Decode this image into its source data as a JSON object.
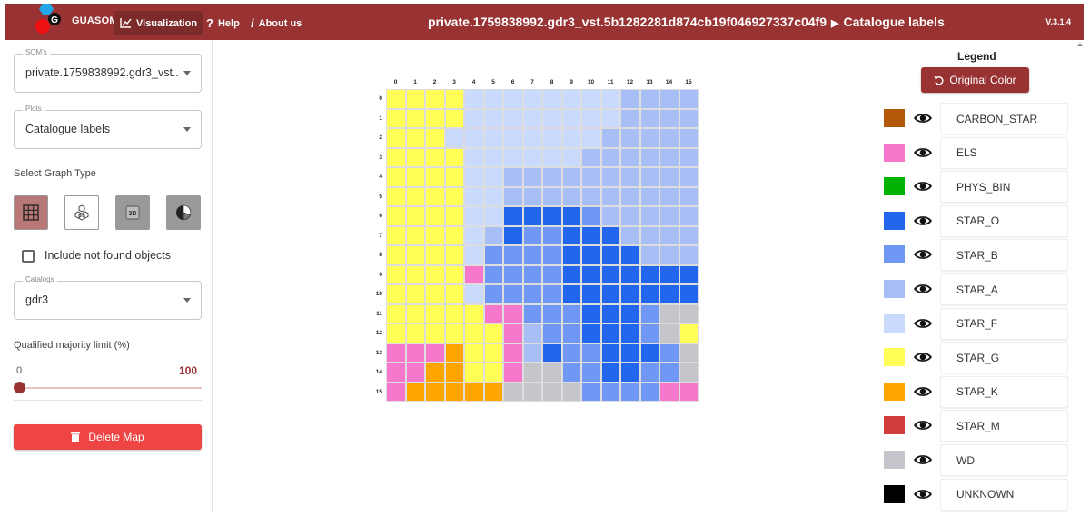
{
  "app": {
    "brand": "GUASOM",
    "nav": [
      {
        "label": "Visualization",
        "icon": "chart-icon"
      },
      {
        "label": "Help",
        "icon": "help-icon"
      },
      {
        "label": "About us",
        "icon": "info-icon"
      }
    ],
    "title_map": "private.1759838992.gdr3_vst.5b1282281d874cb19f046927337c04f9",
    "title_plot": "Catalogue labels",
    "version": "V.3.1.4",
    "colors": {
      "brand": "#993333",
      "brand_dark": "#7d2a2a",
      "danger": "#ee4444"
    }
  },
  "left": {
    "soms_label": "SOM's",
    "soms_value": "private.1759838992.gdr3_vst...",
    "plots_label": "Plots",
    "plots_value": "Catalogue labels",
    "graph_type_label": "Select Graph Type",
    "graph_types": [
      {
        "name": "square-grid",
        "selected": true
      },
      {
        "name": "hexagon-grid",
        "selected": false
      },
      {
        "name": "3d-view",
        "selected": false
      },
      {
        "name": "pie-chart",
        "selected": false
      }
    ],
    "include_label": "Include not found objects",
    "include_checked": false,
    "catalogs_label": "Catalogs",
    "catalogs_value": "gdr3",
    "majority_label": "Qualified majority limit (%)",
    "slider_min": "0",
    "slider_max": "100",
    "slider_value": 0,
    "delete_label": "Delete Map"
  },
  "grid": {
    "col_labels": [
      "0",
      "1",
      "2",
      "3",
      "4",
      "5",
      "6",
      "7",
      "8",
      "9",
      "10",
      "11",
      "12",
      "13",
      "14",
      "15"
    ],
    "row_labels": [
      "0",
      "1",
      "2",
      "3",
      "4",
      "5",
      "6",
      "7",
      "8",
      "9",
      "10",
      "11",
      "12",
      "13",
      "14",
      "15"
    ],
    "cells": [
      [
        "G",
        "G",
        "G",
        "G",
        "F",
        "F",
        "F",
        "F",
        "F",
        "F",
        "F",
        "F",
        "A",
        "A",
        "A",
        "A"
      ],
      [
        "G",
        "G",
        "G",
        "G",
        "F",
        "F",
        "F",
        "F",
        "F",
        "F",
        "F",
        "F",
        "A",
        "A",
        "A",
        "A"
      ],
      [
        "G",
        "G",
        "G",
        "F",
        "F",
        "F",
        "F",
        "F",
        "F",
        "F",
        "F",
        "A",
        "A",
        "A",
        "A",
        "A"
      ],
      [
        "G",
        "G",
        "G",
        "G",
        "F",
        "F",
        "F",
        "F",
        "F",
        "F",
        "A",
        "A",
        "A",
        "A",
        "A",
        "A"
      ],
      [
        "G",
        "G",
        "G",
        "G",
        "F",
        "F",
        "A",
        "A",
        "A",
        "A",
        "A",
        "A",
        "A",
        "A",
        "A",
        "A"
      ],
      [
        "G",
        "G",
        "G",
        "G",
        "F",
        "F",
        "A",
        "A",
        "A",
        "A",
        "A",
        "A",
        "A",
        "A",
        "A",
        "A"
      ],
      [
        "G",
        "G",
        "G",
        "G",
        "F",
        "F",
        "O",
        "O",
        "O",
        "O",
        "B",
        "A",
        "A",
        "A",
        "A",
        "A"
      ],
      [
        "G",
        "G",
        "G",
        "G",
        "F",
        "A",
        "O",
        "B",
        "B",
        "O",
        "O",
        "O",
        "A",
        "A",
        "A",
        "A"
      ],
      [
        "G",
        "G",
        "G",
        "G",
        "F",
        "B",
        "B",
        "B",
        "B",
        "O",
        "O",
        "O",
        "O",
        "A",
        "A",
        "A"
      ],
      [
        "G",
        "G",
        "G",
        "G",
        "E",
        "B",
        "B",
        "B",
        "B",
        "O",
        "O",
        "O",
        "O",
        "O",
        "O",
        "O"
      ],
      [
        "G",
        "G",
        "G",
        "G",
        "F",
        "B",
        "B",
        "B",
        "B",
        "O",
        "O",
        "O",
        "O",
        "O",
        "O",
        "O"
      ],
      [
        "G",
        "G",
        "G",
        "G",
        "G",
        "E",
        "E",
        "B",
        "B",
        "B",
        "O",
        "O",
        "O",
        "B",
        "W",
        "W"
      ],
      [
        "G",
        "G",
        "G",
        "G",
        "G",
        "G",
        "E",
        "A",
        "B",
        "B",
        "O",
        "O",
        "O",
        "B",
        "W",
        "G"
      ],
      [
        "E",
        "E",
        "E",
        "K",
        "G",
        "G",
        "E",
        "A",
        "O",
        "B",
        "B",
        "O",
        "O",
        "O",
        "B",
        "W"
      ],
      [
        "E",
        "E",
        "K",
        "K",
        "G",
        "G",
        "E",
        "W",
        "W",
        "B",
        "B",
        "O",
        "O",
        "B",
        "B",
        "W"
      ],
      [
        "E",
        "K",
        "K",
        "K",
        "K",
        "K",
        "W",
        "W",
        "W",
        "W",
        "B",
        "B",
        "B",
        "B",
        "E",
        "E"
      ]
    ],
    "palette": {
      "C": "#b35806",
      "E": "#f777cc",
      "P": "#00b300",
      "O": "#2266ee",
      "B": "#6f97f3",
      "A": "#a8bef7",
      "F": "#c9dafc",
      "G": "#ffff55",
      "K": "#ffa500",
      "M": "#d23c3c",
      "W": "#c4c6cc",
      "U": "#000000"
    }
  },
  "legend": {
    "title": "Legend",
    "original_color_label": "Original Color",
    "items": [
      {
        "code": "C",
        "label": "CARBON_STAR",
        "color": "#b35806"
      },
      {
        "code": "E",
        "label": "ELS",
        "color": "#f777cc"
      },
      {
        "code": "P",
        "label": "PHYS_BIN",
        "color": "#00b300"
      },
      {
        "code": "O",
        "label": "STAR_O",
        "color": "#2266ee"
      },
      {
        "code": "B",
        "label": "STAR_B",
        "color": "#6f97f3"
      },
      {
        "code": "A",
        "label": "STAR_A",
        "color": "#a8bef7"
      },
      {
        "code": "F",
        "label": "STAR_F",
        "color": "#c9dafc"
      },
      {
        "code": "G",
        "label": "STAR_G",
        "color": "#ffff55"
      },
      {
        "code": "K",
        "label": "STAR_K",
        "color": "#ffa500"
      },
      {
        "code": "M",
        "label": "STAR_M",
        "color": "#d23c3c"
      },
      {
        "code": "W",
        "label": "WD",
        "color": "#c4c6cc"
      },
      {
        "code": "U",
        "label": "UNKNOWN",
        "color": "#000000"
      }
    ]
  }
}
